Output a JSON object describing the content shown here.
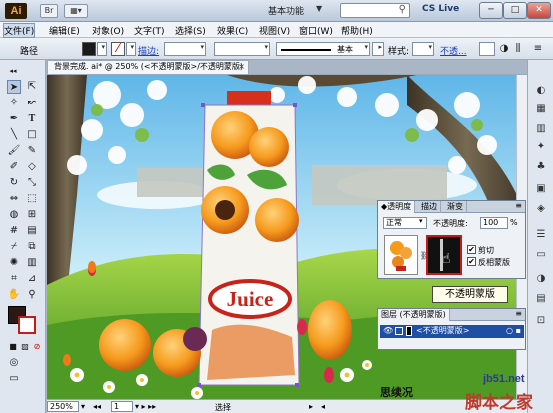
{
  "titlebar": {
    "logo": "Ai",
    "bridge": "Br",
    "workspace": "基本功能",
    "cslive": "CS Live",
    "min": "─",
    "max": "□",
    "close": "✕"
  },
  "menus": [
    "文件(F)",
    "编辑(E)",
    "对象(O)",
    "文字(T)",
    "选择(S)",
    "效果(C)",
    "视图(V)",
    "窗口(W)",
    "帮助(H)"
  ],
  "control": {
    "path_label": "路径",
    "stroke_label": "描边:",
    "basic_label": "基本",
    "style_label": "样式:",
    "opacity_link": "不透..."
  },
  "document": {
    "tab_title": "背景完成. ai* @ 250% (<不透明蒙版>/不透明蒙版)",
    "tab_close": "×"
  },
  "canvas": {
    "juice_label": "Juice",
    "watermark_text": "WWW"
  },
  "transparency": {
    "tabs": [
      "◆透明度",
      "描边",
      "渐变"
    ],
    "blend_mode": "正常",
    "opacity_label": "不透明度:",
    "opacity_value": "100",
    "opacity_unit": "%",
    "clip_label": "剪切",
    "clip_checked": "✔",
    "invert_label": "反相蒙版",
    "invert_checked": "✔"
  },
  "tooltip": "不透明蒙版",
  "layers": {
    "title": "图层 (不透明蒙版)",
    "row_label": "<不透明蒙版>"
  },
  "status": {
    "zoom": "250%",
    "page": "1",
    "mode": "选择"
  },
  "overlay": {
    "stroke_text": "思续况",
    "url": "jb51.net",
    "site_cn": "脚本之家"
  },
  "colors": {
    "accent": "#1f4ea5",
    "mask_border": "#c41a1a"
  }
}
